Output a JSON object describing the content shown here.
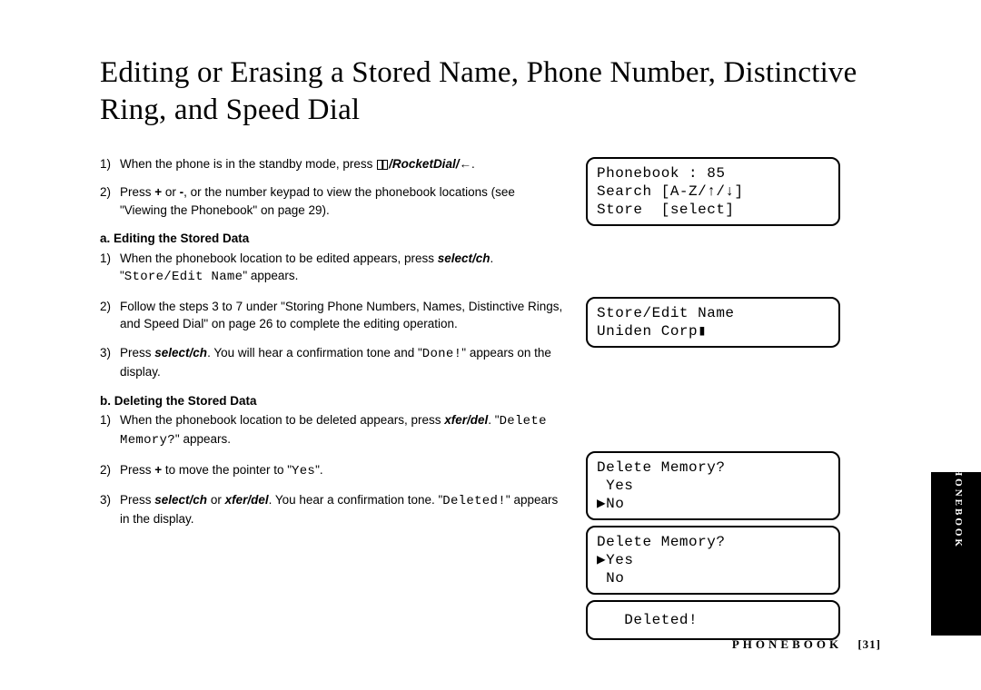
{
  "title": "Editing or Erasing a Stored Name, Phone Number, Distinctive Ring, and Speed Dial",
  "steps": {
    "s1_num": "1)",
    "s1_a": "When the phone is in the standby mode, press ",
    "s1_b": "/RocketDial/←",
    "s1_c": ".",
    "s2_num": "2)",
    "s2_a": "Press ",
    "s2_b": "+",
    "s2_c": " or ",
    "s2_d": "-",
    "s2_e": ", or the number keypad to view the phonebook locations (see \"Viewing the Phonebook\" on page 29).",
    "sub_a": "a. Editing the Stored Data",
    "a1_num": "1)",
    "a1_a": "When the phonebook location to be edited appears, press ",
    "a1_b": "select/ch",
    "a1_c": ". \"",
    "a1_d": "Store/Edit Name",
    "a1_e": "\" appears.",
    "a2_num": "2)",
    "a2": "Follow the steps 3 to 7 under \"Storing Phone Numbers, Names, Distinctive Rings, and Speed Dial\" on page 26 to complete the editing operation.",
    "a3_num": "3)",
    "a3_a": "Press ",
    "a3_b": "select/ch",
    "a3_c": ". You will hear a confirmation tone and \"",
    "a3_d": "Done!",
    "a3_e": "\" appears on the display.",
    "sub_b": "b. Deleting the Stored Data",
    "b1_num": "1)",
    "b1_a": "When the phonebook location to be deleted appears, press ",
    "b1_b": "xfer/del",
    "b1_c": ". \"",
    "b1_d": "Delete Memory?",
    "b1_e": "\" appears.",
    "b2_num": "2)",
    "b2_a": "Press ",
    "b2_b": "+",
    "b2_c": " to move the pointer to \"",
    "b2_d": "Yes",
    "b2_e": "\".",
    "b3_num": "3)",
    "b3_a": "Press ",
    "b3_b": "select/ch",
    "b3_c": " or ",
    "b3_d": "xfer/del",
    "b3_e": ". You hear a confirmation tone. \"",
    "b3_f": "Deleted!",
    "b3_g": "\" appears in the display."
  },
  "screens": {
    "scr1": "Phonebook : 85\nSearch [A-Z/↑/↓]\nStore  [select]",
    "scr2": "Store/Edit Name\nUniden Corp▮",
    "scr3": "Delete Memory?\n Yes\n▶No",
    "scr4": "Delete Memory?\n▶Yes\n No",
    "scr5": "   Deleted!"
  },
  "footer": {
    "section": "PHONEBOOK",
    "page": "[31]"
  },
  "side": "PHONEBOOK"
}
